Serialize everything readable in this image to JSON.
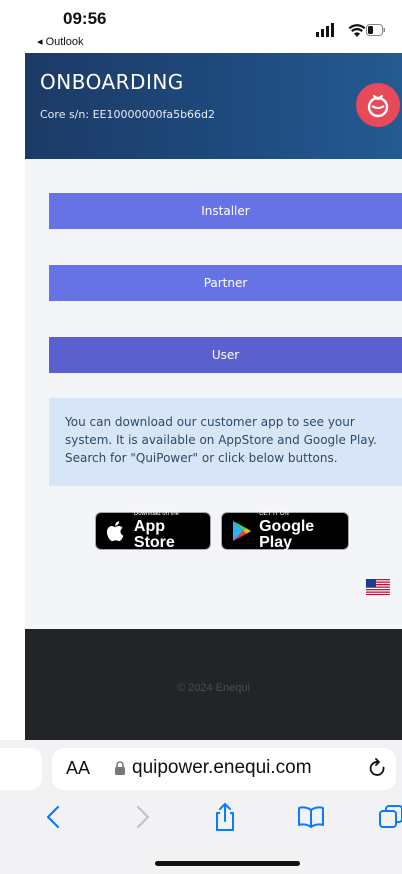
{
  "status_bar": {
    "time": "09:56",
    "back_app": "◂ Outlook"
  },
  "header": {
    "title": "ONBOARDING",
    "serial": "Core s/n: EE10000000fa5b66d2"
  },
  "roles": [
    {
      "label": "Installer"
    },
    {
      "label": "Partner"
    },
    {
      "label": "User"
    }
  ],
  "info": {
    "text": "You can download our customer app to see your system. It is available on AppStore and Google Play. Search for \"QuiPower\" or click below buttons."
  },
  "stores": {
    "apple": {
      "small": "Download on the",
      "big": "App Store"
    },
    "google": {
      "small": "GET IT ON",
      "big": "Google Play"
    }
  },
  "language": {
    "flag": "us-flag-icon"
  },
  "footer": {
    "copyright": "© 2024 Enequi"
  },
  "safari": {
    "aa": "AA",
    "url": "quipower.enequi.com"
  },
  "colors": {
    "header": "#1f4c80",
    "role_button": "#6673e6",
    "role_button_active": "#5a60cd",
    "info_bg": "#d7e5f6",
    "logo": "#e84a59",
    "footer": "#222427",
    "safari_blue": "#0a7aff"
  }
}
